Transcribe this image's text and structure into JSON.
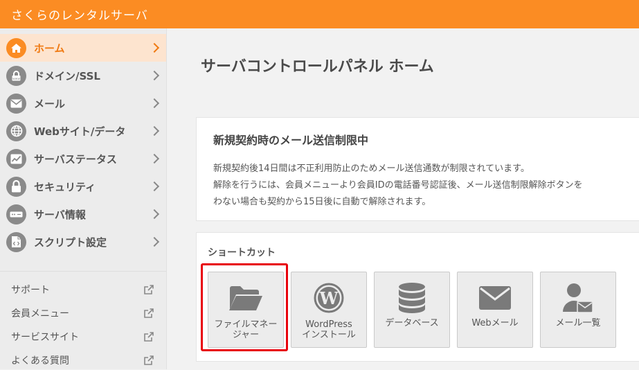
{
  "app": {
    "title": "さくらのレンタルサーバ"
  },
  "colors": {
    "brand": "#fb8c23",
    "highlight": "#e8000b"
  },
  "sidebar": {
    "items": [
      {
        "label": "ホーム",
        "icon": "home-icon",
        "active": true
      },
      {
        "label": "ドメイン/SSL",
        "icon": "lock-www-icon"
      },
      {
        "label": "メール",
        "icon": "mail-icon"
      },
      {
        "label": "Webサイト/データ",
        "icon": "globe-icon"
      },
      {
        "label": "サーバステータス",
        "icon": "chart-icon"
      },
      {
        "label": "セキュリティ",
        "icon": "lock-icon"
      },
      {
        "label": "サーバ情報",
        "icon": "server-icon"
      },
      {
        "label": "スクリプト設定",
        "icon": "script-icon"
      }
    ],
    "links": [
      {
        "label": "サポート",
        "icon": "external-link-icon"
      },
      {
        "label": "会員メニュー",
        "icon": "external-link-icon"
      },
      {
        "label": "サービスサイト",
        "icon": "external-link-icon"
      },
      {
        "label": "よくある質問",
        "icon": "external-link-icon"
      }
    ]
  },
  "main": {
    "title": "サーバコントロールパネル ホーム",
    "notice": {
      "title": "新規契約時のメール送信制限中",
      "lines": [
        "新規契約後14日間は不正利用防止のためメール送信通数が制限されています。",
        "解除を行うには、会員メニューより会員IDの電話番号認証後、メール送信制限解除ボタンを",
        "わない場合も契約から15日後に自動で解除されます。"
      ]
    },
    "shortcuts": {
      "title": "ショートカット",
      "items": [
        {
          "label_line1": "ファイルマネー",
          "label_line2": "ジャー",
          "icon": "folder-icon"
        },
        {
          "label_line1": "WordPress",
          "label_line2": "インストール",
          "icon": "wordpress-icon"
        },
        {
          "label_line1": "データベース",
          "label_line2": "",
          "icon": "database-icon"
        },
        {
          "label_line1": "Webメール",
          "label_line2": "",
          "icon": "envelope-icon"
        },
        {
          "label_line1": "メール一覧",
          "label_line2": "",
          "icon": "user-mail-icon"
        }
      ]
    }
  }
}
